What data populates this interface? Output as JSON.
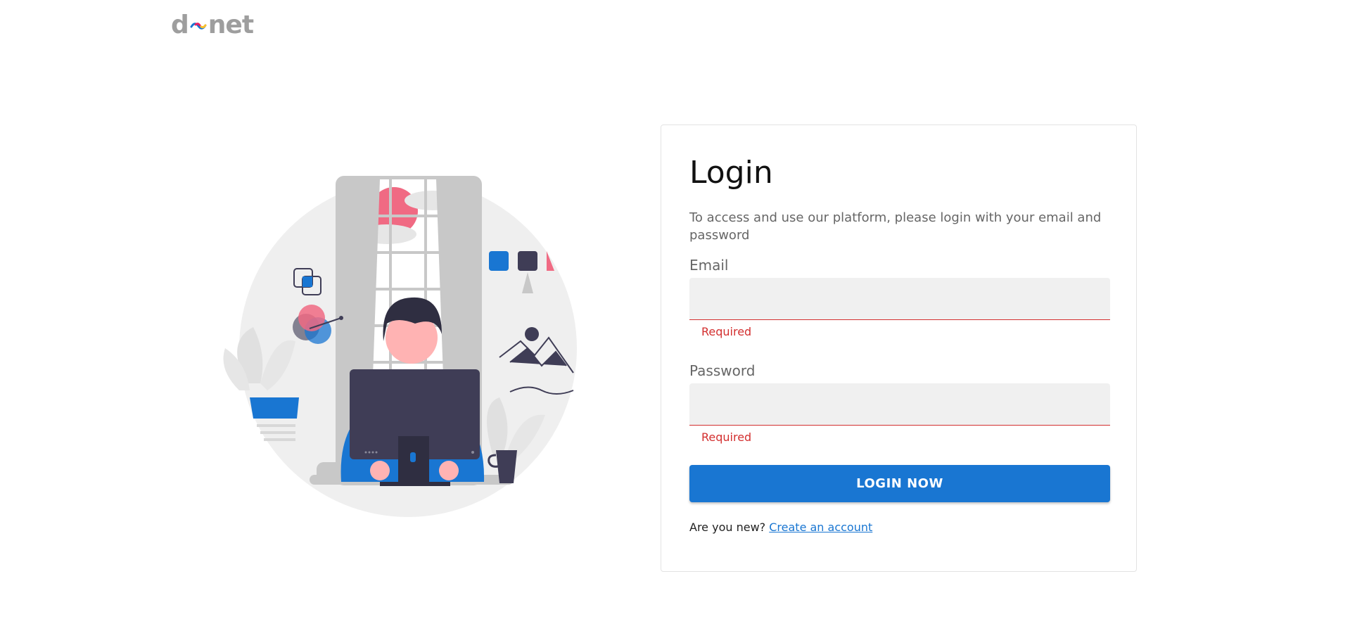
{
  "brand": {
    "logo_left": "d",
    "logo_right": "net",
    "colors": {
      "logo_text": "#9e9e9e",
      "wave": [
        "#1976d2",
        "#e91e63",
        "#fbc02d"
      ]
    }
  },
  "illustration": {
    "icon": "person-at-computer-illustration",
    "colors": {
      "circle": "#efefef",
      "window": "#cccccc",
      "accent_blue": "#1976d2",
      "accent_pink": "#f06a83",
      "skin": "#ffb3b3",
      "dark": "#3f3d56"
    }
  },
  "login": {
    "title": "Login",
    "description": "To access and use our platform, please login with your email and password",
    "email_label": "Email",
    "email_value": "",
    "email_error": "Required",
    "password_label": "Password",
    "password_value": "",
    "password_error": "Required",
    "submit_label": "LOGIN NOW",
    "signup_prompt": "Are you new?",
    "signup_link": "Create an account"
  },
  "colors": {
    "primary": "#1976d2",
    "error": "#d32f2f",
    "input_bg": "#f0f0f0",
    "card_border": "#e3e3e3"
  }
}
